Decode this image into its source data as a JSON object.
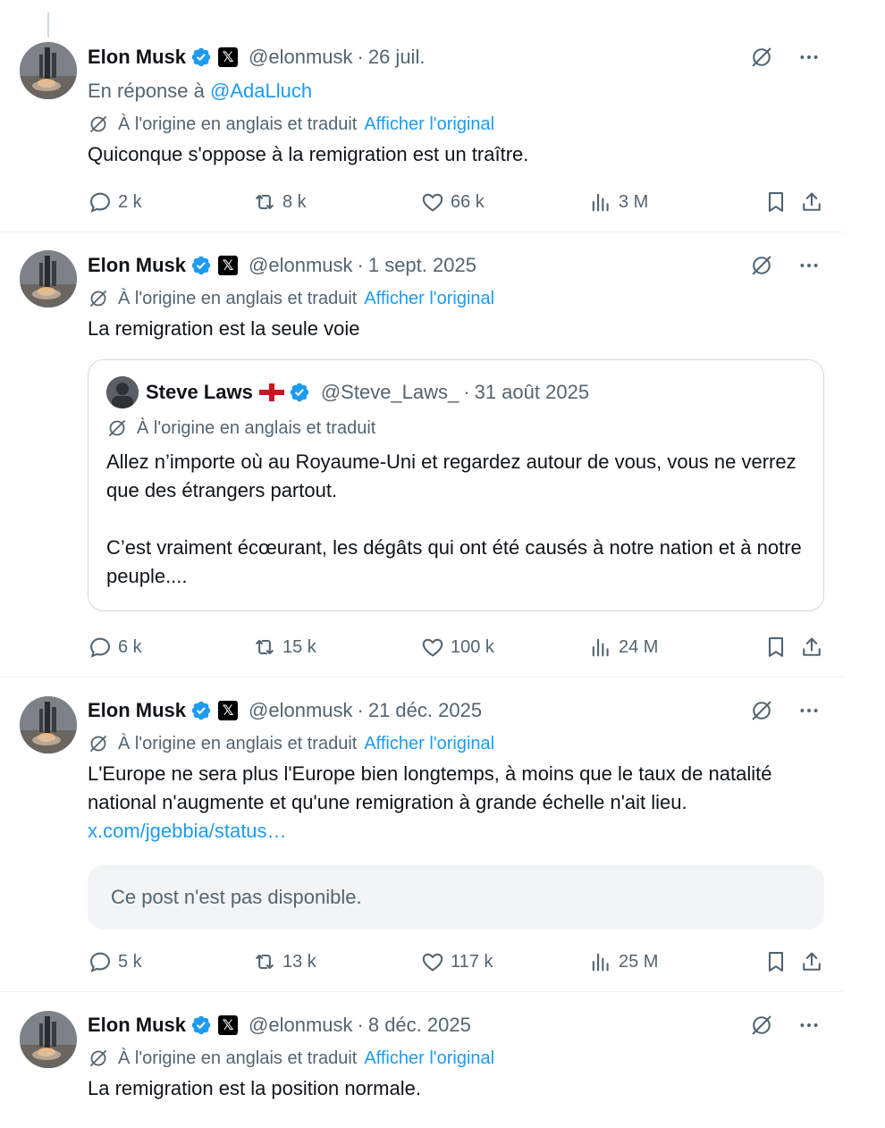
{
  "colors": {
    "link": "#1d9bf0",
    "verified": "#1d9bf0",
    "muted": "#536471",
    "text": "#0f1419"
  },
  "icons": [
    "verified-badge-icon",
    "x-logo-icon",
    "grok-translate-icon",
    "more-icon",
    "reply-icon",
    "retweet-icon",
    "like-icon",
    "views-icon",
    "bookmark-icon",
    "share-icon",
    "england-flag-icon"
  ],
  "tweets": [
    {
      "name": "Elon Musk",
      "handle": "@elonmusk",
      "sep": "·",
      "time": "26 juil.",
      "reply_prefix": "En réponse à ",
      "reply_handle": "@AdaLluch",
      "translated": "À l'origine en anglais et traduit",
      "show_original": "Afficher l'original",
      "text": "Quiconque s'oppose à la remigration est un traître.",
      "replies": "2 k",
      "retweets": "8 k",
      "likes": "66 k",
      "views": "3 M"
    },
    {
      "name": "Elon Musk",
      "handle": "@elonmusk",
      "sep": "·",
      "time": "1 sept. 2025",
      "translated": "À l'origine en anglais et traduit",
      "show_original": "Afficher l'original",
      "text": "La remigration est la seule voie",
      "quote": {
        "name": "Steve Laws",
        "handle": "@Steve_Laws_",
        "sep": "·",
        "time": "31 août 2025",
        "translated": "À l'origine en anglais et traduit",
        "text": "Allez n’importe où au Royaume-Uni et regardez autour de vous, vous ne verrez que des étrangers partout.\n\nC’est vraiment écœurant, les dégâts qui ont été causés à notre nation et à notre peuple...."
      },
      "replies": "6 k",
      "retweets": "15 k",
      "likes": "100 k",
      "views": "24 M"
    },
    {
      "name": "Elon Musk",
      "handle": "@elonmusk",
      "sep": "·",
      "time": "21 déc. 2025",
      "translated": "À l'origine en anglais et traduit",
      "show_original": "Afficher l'original",
      "text": "L'Europe ne sera plus l'Europe bien longtemps, à moins que le taux de natalité national n'augmente et qu'une remigration à grande échelle n'ait lieu.",
      "link": "x.com/jgebbia/status…",
      "unavailable": "Ce post n'est pas disponible.",
      "replies": "5 k",
      "retweets": "13 k",
      "likes": "117 k",
      "views": "25 M"
    },
    {
      "name": "Elon Musk",
      "handle": "@elonmusk",
      "sep": "·",
      "time": "8 déc. 2025",
      "translated": "À l'origine en anglais et traduit",
      "show_original": "Afficher l'original",
      "text": "La remigration est la position normale."
    }
  ]
}
